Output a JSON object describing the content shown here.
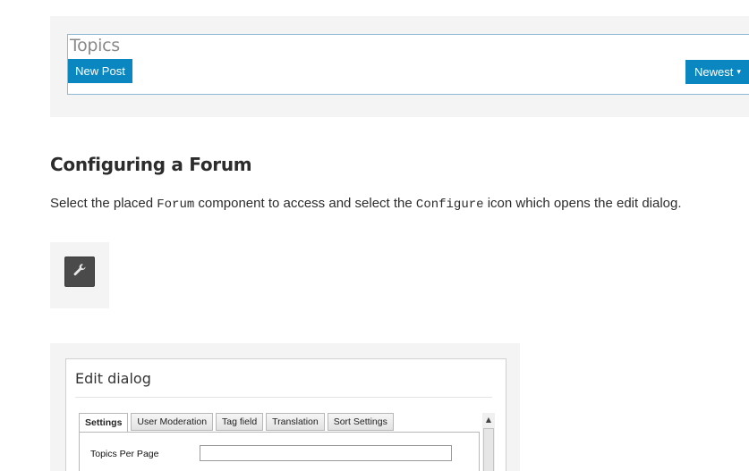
{
  "topics_widget": {
    "title": "Topics",
    "new_post_label": "New Post",
    "sort_label": "Newest",
    "sort_caret": "▾",
    "accent_color": "#0a87c1"
  },
  "section": {
    "heading": "Configuring a Forum",
    "paragraph": {
      "part1": "Select the placed ",
      "code1": "Forum",
      "part2": " component to access and select the ",
      "code2": "Configure",
      "part3": " icon which opens the edit dialog."
    }
  },
  "configure_icon": {
    "icon": "wrench-icon"
  },
  "edit_dialog": {
    "title": "Edit dialog",
    "tabs": [
      {
        "label": "Settings",
        "active": true
      },
      {
        "label": "User Moderation",
        "active": false
      },
      {
        "label": "Tag field",
        "active": false
      },
      {
        "label": "Translation",
        "active": false
      },
      {
        "label": "Sort Settings",
        "active": false
      }
    ],
    "fields": [
      {
        "label": "Topics Per Page",
        "value": ""
      }
    ],
    "scroll_up_glyph": "▲"
  }
}
